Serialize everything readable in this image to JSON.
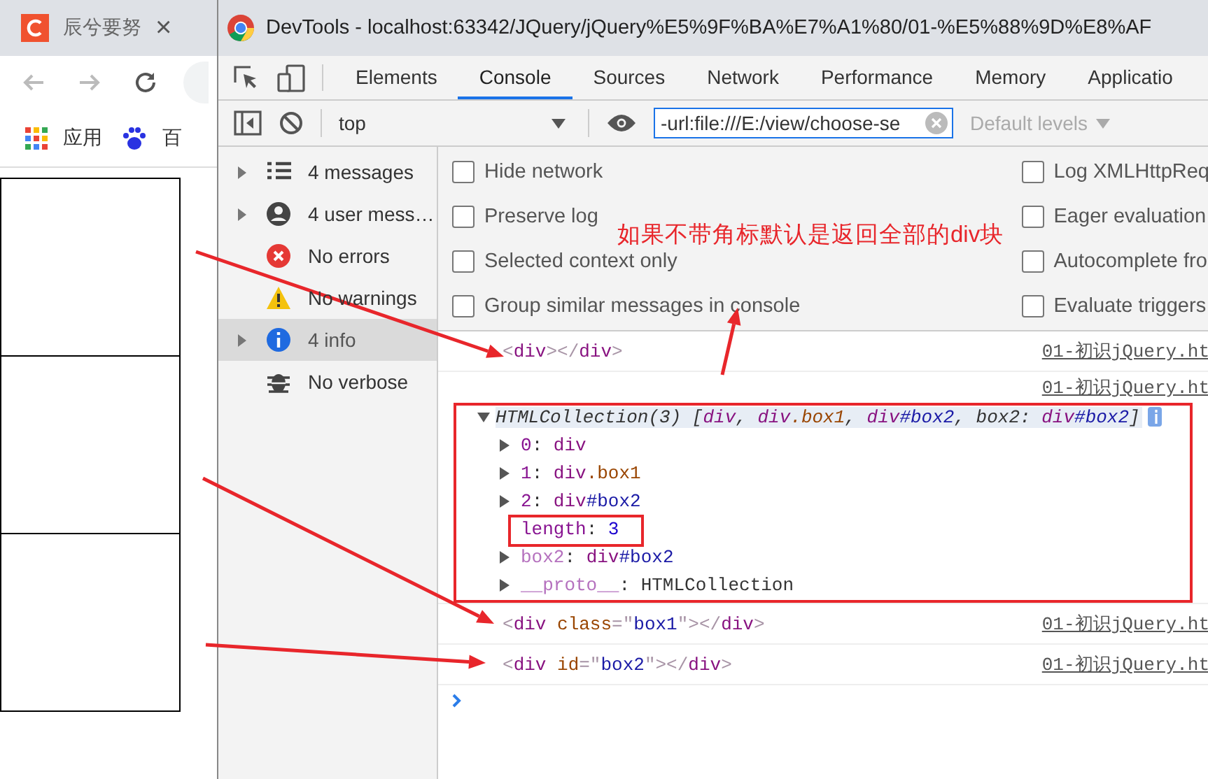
{
  "browser": {
    "tab": {
      "title": "辰兮要努",
      "close": "×"
    },
    "bookmarks": [
      {
        "kind": "apps",
        "label": "应用"
      },
      {
        "kind": "paw",
        "label": "百"
      }
    ]
  },
  "devtools": {
    "title": "DevTools - localhost:63342/JQuery/jQuery%E5%9F%BA%E7%A1%80/01-%E5%88%9D%E8%AF",
    "tabs": [
      {
        "label": "Elements",
        "selected": false
      },
      {
        "label": "Console",
        "selected": true
      },
      {
        "label": "Sources",
        "selected": false
      },
      {
        "label": "Network",
        "selected": false
      },
      {
        "label": "Performance",
        "selected": false
      },
      {
        "label": "Memory",
        "selected": false
      },
      {
        "label": "Applicatio",
        "selected": false
      }
    ],
    "toolbar": {
      "context": "top",
      "filter": "-url:file:///E:/view/choose-se",
      "levels": "Default levels"
    },
    "sidebar": {
      "items": [
        {
          "kind": "list",
          "label": "4 messages",
          "expandable": true,
          "selected": false
        },
        {
          "kind": "user",
          "label": "4 user mess…",
          "expandable": true,
          "selected": false
        },
        {
          "kind": "error",
          "label": "No errors",
          "expandable": false,
          "selected": false
        },
        {
          "kind": "warning",
          "label": "No warnings",
          "expandable": false,
          "selected": false
        },
        {
          "kind": "info",
          "label": "4 info",
          "expandable": true,
          "selected": true
        },
        {
          "kind": "bug",
          "label": "No verbose",
          "expandable": false,
          "selected": false
        }
      ]
    },
    "settings": {
      "left": [
        {
          "label": "Hide network",
          "checked": false
        },
        {
          "label": "Preserve log",
          "checked": false
        },
        {
          "label": "Selected context only",
          "checked": false
        },
        {
          "label": "Group similar messages in console",
          "checked": false
        }
      ],
      "right": [
        {
          "label": "Log XMLHttpReq",
          "checked": false
        },
        {
          "label": "Eager evaluation",
          "checked": false
        },
        {
          "label": "Autocomplete fro",
          "checked": false
        },
        {
          "label": "Evaluate triggers",
          "checked": false
        }
      ]
    },
    "messages": [
      {
        "kind": "element",
        "source": "01-初识jQuery.ht",
        "tokens": [
          {
            "kind": "bracket",
            "text": "<"
          },
          {
            "kind": "tag",
            "text": "div"
          },
          {
            "kind": "bracket",
            "text": "></"
          },
          {
            "kind": "tag",
            "text": "div"
          },
          {
            "kind": "bracket",
            "text": ">"
          }
        ]
      },
      {
        "kind": "object",
        "source": "01-初识jQuery.ht",
        "tree": {
          "expanded": true,
          "tokens": [
            {
              "kind": "plain",
              "text": "HTMLCollection(3) ["
            },
            {
              "kind": "tag",
              "text": "div"
            },
            {
              "kind": "plain",
              "text": ", "
            },
            {
              "kind": "tag",
              "text": "div"
            },
            {
              "kind": "attr",
              "text": ".box1"
            },
            {
              "kind": "plain",
              "text": ", "
            },
            {
              "kind": "tag",
              "text": "div"
            },
            {
              "kind": "value",
              "text": "#box2"
            },
            {
              "kind": "plain",
              "text": ", box2: "
            },
            {
              "kind": "tag",
              "text": "div"
            },
            {
              "kind": "value",
              "text": "#box2"
            },
            {
              "kind": "plain",
              "text": "]"
            }
          ],
          "children": [
            {
              "expandable": true,
              "tokens": [
                {
                  "kind": "key",
                  "text": "0"
                },
                {
                  "kind": "plain",
                  "text": ": "
                },
                {
                  "kind": "tag",
                  "text": "div"
                }
              ]
            },
            {
              "expandable": true,
              "tokens": [
                {
                  "kind": "key",
                  "text": "1"
                },
                {
                  "kind": "plain",
                  "text": ": "
                },
                {
                  "kind": "tag",
                  "text": "div"
                },
                {
                  "kind": "attr",
                  "text": ".box1"
                }
              ]
            },
            {
              "expandable": true,
              "tokens": [
                {
                  "kind": "key",
                  "text": "2"
                },
                {
                  "kind": "plain",
                  "text": ": "
                },
                {
                  "kind": "tag",
                  "text": "div"
                },
                {
                  "kind": "value",
                  "text": "#box2"
                }
              ]
            },
            {
              "expandable": false,
              "tokens": [
                {
                  "kind": "key",
                  "text": "length"
                },
                {
                  "kind": "plain",
                  "text": ": "
                },
                {
                  "kind": "number",
                  "text": "3"
                }
              ]
            },
            {
              "expandable": true,
              "tokens": [
                {
                  "kind": "dimkey",
                  "text": "box2"
                },
                {
                  "kind": "plain",
                  "text": ": "
                },
                {
                  "kind": "tag",
                  "text": "div"
                },
                {
                  "kind": "value",
                  "text": "#box2"
                }
              ]
            },
            {
              "expandable": true,
              "tokens": [
                {
                  "kind": "dimkey",
                  "text": "__proto__"
                },
                {
                  "kind": "plain",
                  "text": ": HTMLCollection"
                }
              ]
            }
          ]
        }
      },
      {
        "kind": "element",
        "source": "01-初识jQuery.ht",
        "tokens": [
          {
            "kind": "bracket",
            "text": "<"
          },
          {
            "kind": "tag",
            "text": "div"
          },
          {
            "kind": "attr",
            "text": " class"
          },
          {
            "kind": "bracket",
            "text": "=\""
          },
          {
            "kind": "value",
            "text": "box1"
          },
          {
            "kind": "bracket",
            "text": "\"></"
          },
          {
            "kind": "tag",
            "text": "div"
          },
          {
            "kind": "bracket",
            "text": ">"
          }
        ]
      },
      {
        "kind": "element",
        "source": "01-初识jQuery.ht",
        "tokens": [
          {
            "kind": "bracket",
            "text": "<"
          },
          {
            "kind": "tag",
            "text": "div"
          },
          {
            "kind": "attr",
            "text": " id"
          },
          {
            "kind": "bracket",
            "text": "=\""
          },
          {
            "kind": "value",
            "text": "box2"
          },
          {
            "kind": "bracket",
            "text": "\"></"
          },
          {
            "kind": "tag",
            "text": "div"
          },
          {
            "kind": "bracket",
            "text": ">"
          }
        ]
      }
    ]
  },
  "annotation": {
    "note": "如果不带角标默认是返回全部的div块"
  }
}
